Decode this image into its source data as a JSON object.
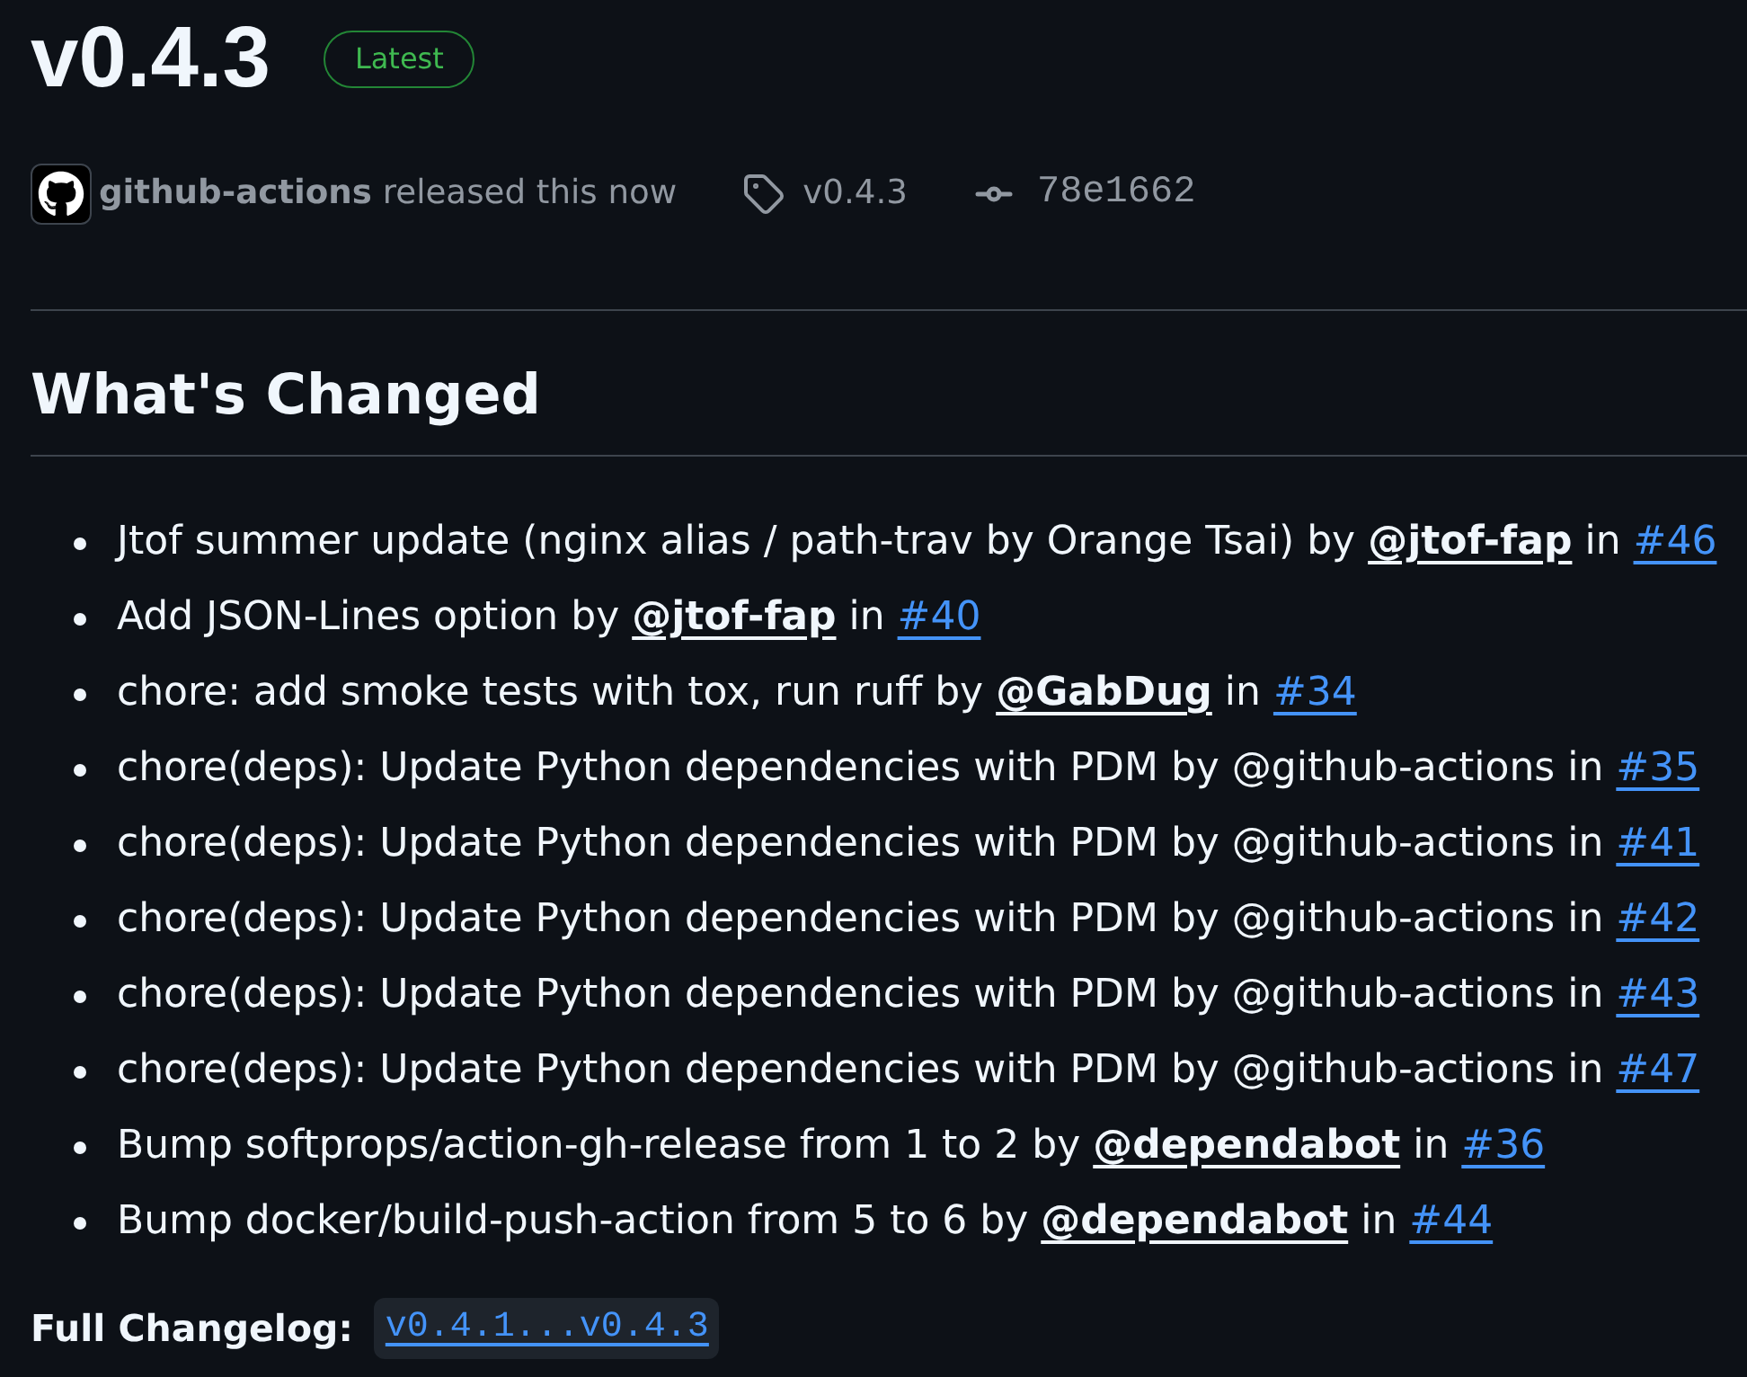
{
  "release": {
    "title": "v0.4.3",
    "badge": "Latest"
  },
  "byline": {
    "author": "github-actions",
    "action": "released this now",
    "tag": "v0.4.3",
    "commit": "78e1662"
  },
  "section": {
    "heading": "What's Changed",
    "items": [
      {
        "parts": [
          {
            "kind": "text",
            "text": "Jtof summer update (nginx alias / path-trav by Orange Tsai) by "
          },
          {
            "kind": "mention",
            "text": "@jtof-fap"
          },
          {
            "kind": "text",
            "text": " in "
          },
          {
            "kind": "issue",
            "text": "#46"
          }
        ]
      },
      {
        "parts": [
          {
            "kind": "text",
            "text": "Add JSON-Lines option by "
          },
          {
            "kind": "mention",
            "text": "@jtof-fap"
          },
          {
            "kind": "text",
            "text": " in "
          },
          {
            "kind": "issue",
            "text": "#40"
          }
        ]
      },
      {
        "parts": [
          {
            "kind": "text",
            "text": "chore: add smoke tests with tox, run ruff by "
          },
          {
            "kind": "mention",
            "text": "@GabDug"
          },
          {
            "kind": "text",
            "text": " in "
          },
          {
            "kind": "issue",
            "text": "#34"
          }
        ]
      },
      {
        "parts": [
          {
            "kind": "text",
            "text": "chore(deps): Update Python dependencies with PDM by @github-actions in "
          },
          {
            "kind": "issue",
            "text": "#35"
          }
        ]
      },
      {
        "parts": [
          {
            "kind": "text",
            "text": "chore(deps): Update Python dependencies with PDM by @github-actions in "
          },
          {
            "kind": "issue",
            "text": "#41"
          }
        ]
      },
      {
        "parts": [
          {
            "kind": "text",
            "text": "chore(deps): Update Python dependencies with PDM by @github-actions in "
          },
          {
            "kind": "issue",
            "text": "#42"
          }
        ]
      },
      {
        "parts": [
          {
            "kind": "text",
            "text": "chore(deps): Update Python dependencies with PDM by @github-actions in "
          },
          {
            "kind": "issue",
            "text": "#43"
          }
        ]
      },
      {
        "parts": [
          {
            "kind": "text",
            "text": "chore(deps): Update Python dependencies with PDM by @github-actions in "
          },
          {
            "kind": "issue",
            "text": "#47"
          }
        ]
      },
      {
        "parts": [
          {
            "kind": "text",
            "text": "Bump softprops/action-gh-release from 1 to 2 by "
          },
          {
            "kind": "mention",
            "text": "@dependabot"
          },
          {
            "kind": "text",
            "text": " in "
          },
          {
            "kind": "issue",
            "text": "#36"
          }
        ]
      },
      {
        "parts": [
          {
            "kind": "text",
            "text": "Bump docker/build-push-action from 5 to 6 by "
          },
          {
            "kind": "mention",
            "text": "@dependabot"
          },
          {
            "kind": "text",
            "text": " in "
          },
          {
            "kind": "issue",
            "text": "#44"
          }
        ]
      }
    ]
  },
  "full_changelog": {
    "label": "Full Changelog:",
    "link": "v0.4.1...v0.4.3"
  }
}
